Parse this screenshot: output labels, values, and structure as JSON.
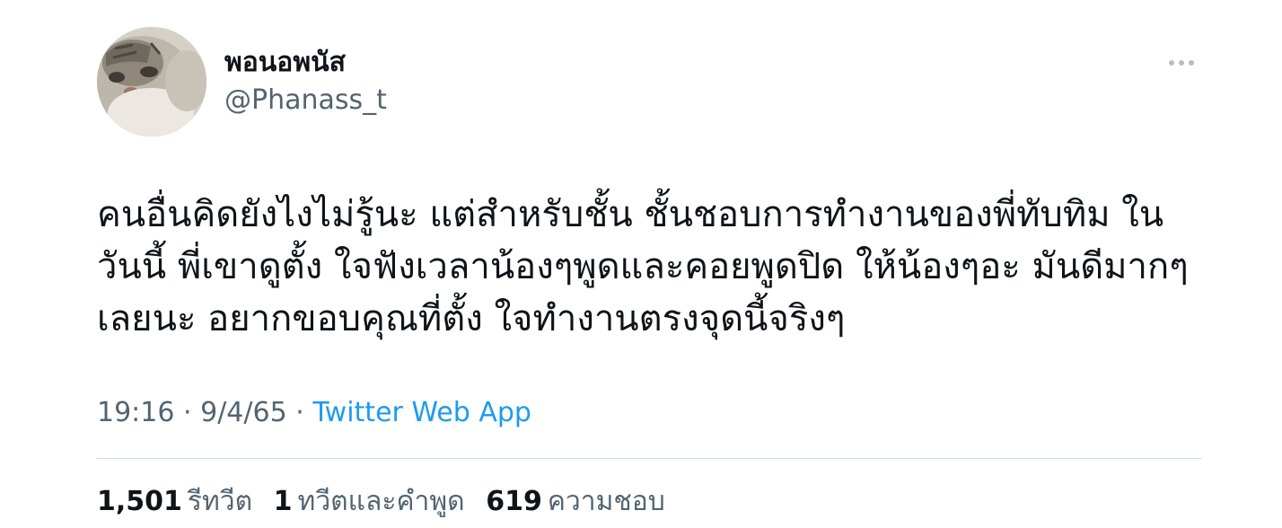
{
  "author": {
    "display_name": "พอนอพนัส",
    "handle": "@Phanass_t"
  },
  "tweet": {
    "text": "คนอื่นคิดยังไงไม่รู้นะ แต่สำหรับชั้น ชั้นชอบการทำงานของพี่ทับทิม ในวันนี้ พี่เขาดูตั้ง ใจฟังเวลาน้องๆพูดและคอยพูดปิด ให้น้องๆอะ มันดีมากๆเลยนะ อยากขอบคุณที่ตั้ง ใจทำงานตรงจุดนี้จริงๆ",
    "time": "19:16",
    "date": "9/4/65",
    "separator": "·",
    "source": "Twitter Web App"
  },
  "stats": {
    "retweets_count": "1,501",
    "retweets_label": "รีทวีต",
    "quotes_count": "1",
    "quotes_label": "ทวีตและคำพูด",
    "likes_count": "619",
    "likes_label": "ความชอบ"
  },
  "icons": {
    "more": "more-horizontal-icon",
    "avatar": "cat-avatar"
  },
  "colors": {
    "text": "#0f1419",
    "secondary": "#536471",
    "link": "#1d9bf0",
    "divider": "#cfd9de"
  }
}
